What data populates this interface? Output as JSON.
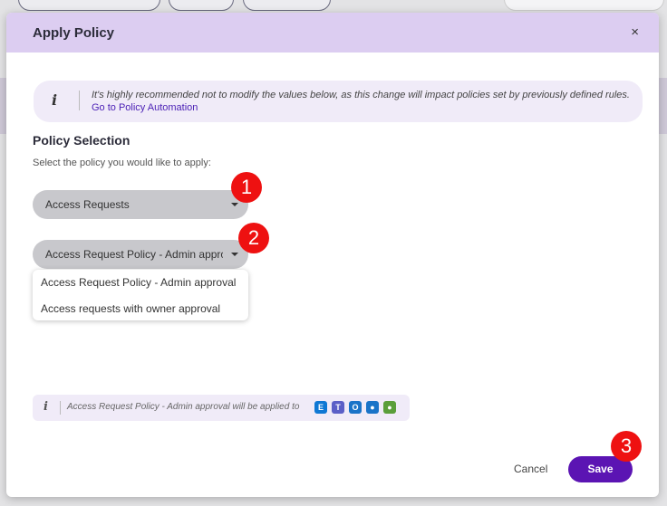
{
  "dialog": {
    "title": "Apply Policy",
    "close_symbol": "×"
  },
  "info_banner": {
    "icon": "info-icon",
    "text": "It's highly recommended not to modify the values below, as this change will impact policies set by previously defined rules.",
    "link": "Go to Policy Automation"
  },
  "policy_selection": {
    "title": "Policy Selection",
    "subtitle": "Select the policy you would like to apply:",
    "category_select": {
      "value": "Access Requests"
    },
    "policy_select": {
      "value": "Access Request Policy - Admin approval"
    },
    "options": [
      "Access Request Policy - Admin approval",
      "Access requests with owner approval"
    ]
  },
  "note": {
    "icon": "info-icon",
    "text": "Access Request Policy - Admin approval will be applied to",
    "app_icons": [
      {
        "name": "exchange-icon",
        "color": "#0f78d4"
      },
      {
        "name": "teams-icon",
        "color": "#5b5fc7"
      },
      {
        "name": "outlook-icon",
        "color": "#1a73c8"
      },
      {
        "name": "group-icon",
        "color": "#1a73c8"
      },
      {
        "name": "users-icon",
        "color": "#5a9e3a"
      }
    ]
  },
  "footer": {
    "cancel_label": "Cancel",
    "save_label": "Save"
  },
  "step_badges": [
    "1",
    "2",
    "3"
  ],
  "colors": {
    "accent": "#5b14b3",
    "header_bg": "#dccdf1",
    "badge": "#ee1111"
  }
}
